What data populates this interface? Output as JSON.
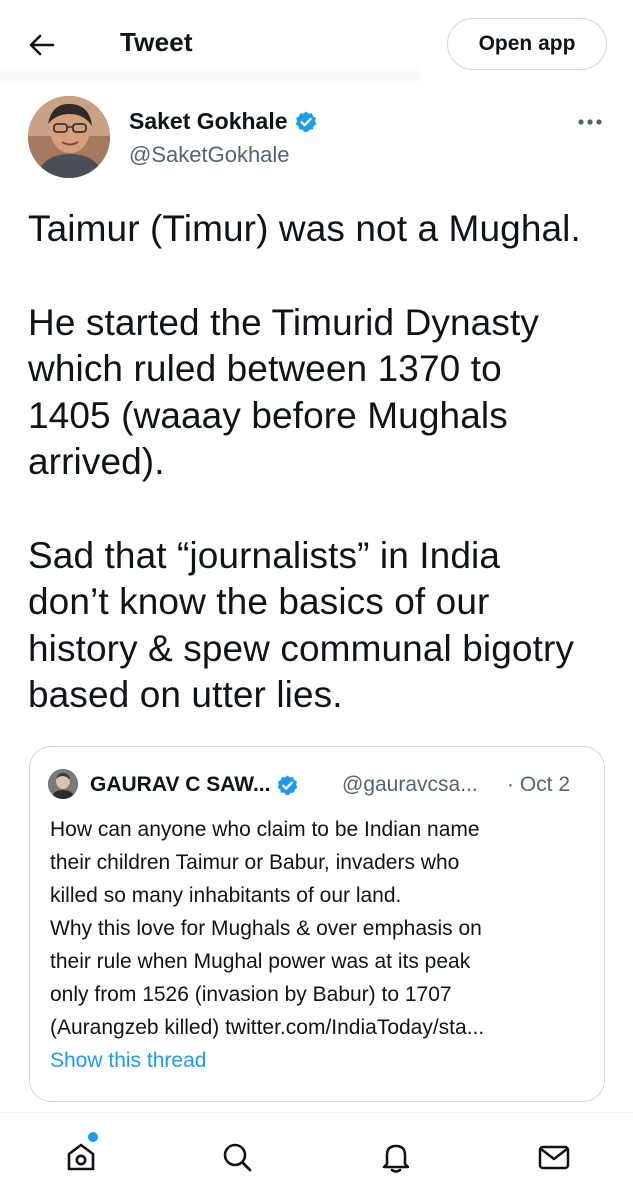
{
  "header": {
    "title": "Tweet",
    "open_app_label": "Open app",
    "back_icon": "arrow-left-icon"
  },
  "tweet": {
    "author_name": "Saket Gokhale",
    "author_handle": "@SaketGokhale",
    "verified": true,
    "more_icon": "more-horizontal-icon",
    "paragraphs": [
      [
        "Taimur (Timur) was not a Mughal."
      ],
      [
        "He started the Timurid Dynasty",
        "which ruled between 1370 to",
        "1405 (waaay before Mughals",
        "arrived)."
      ],
      [
        "Sad that “journalists” in India",
        "don’t know the basics of our",
        "history & spew communal bigotry",
        "based on utter lies."
      ]
    ]
  },
  "quote": {
    "author_name": "GAURAV C SAW...",
    "author_handle": "@gauravcsa...",
    "date": "· Oct 2",
    "verified": true,
    "lines": [
      "How can anyone who claim to be Indian name",
      "their children Taimur or Babur, invaders who",
      "killed so many inhabitants of our land.",
      "Why this love for Mughals & over emphasis on",
      "their rule when Mughal power was at its peak",
      "only from 1526 (invasion by Babur) to 1707",
      "(Aurangzeb killed) twitter.com/IndiaToday/sta..."
    ],
    "show_thread_label": "Show this thread"
  },
  "bottom_nav": {
    "items": [
      "home-icon",
      "search-icon",
      "notifications-icon",
      "messages-icon"
    ],
    "home_has_notification": true
  },
  "colors": {
    "accent": "#1d9bf0",
    "text_primary": "#0f1419",
    "text_secondary": "#536471",
    "border": "#cfd9de"
  }
}
